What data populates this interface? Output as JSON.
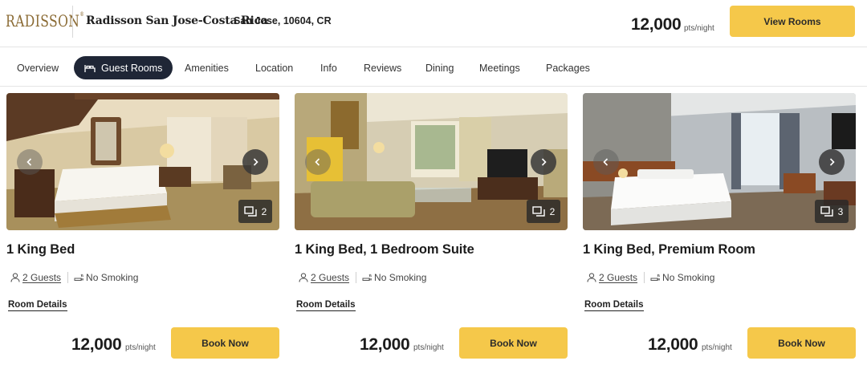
{
  "header": {
    "logo_text": "RADISSON",
    "logo_mark": "®",
    "hotel_name": "Radisson San Jose-Costa Rica",
    "address": "San Jose, 10604, CR",
    "price": "12,000",
    "price_unit": "pts/night",
    "view_rooms_label": "View Rooms",
    "accent_color": "#f5c84a",
    "brand_color": "#8a6a33"
  },
  "nav": {
    "active_color": "#1f2636",
    "tabs": [
      {
        "label": "Overview",
        "active": false
      },
      {
        "label": "Guest Rooms",
        "active": true,
        "icon": "bed-icon"
      },
      {
        "label": "Amenities",
        "active": false
      },
      {
        "label": "Location",
        "active": false
      },
      {
        "label": "Info",
        "active": false
      },
      {
        "label": "Reviews",
        "active": false
      },
      {
        "label": "Dining",
        "active": false
      },
      {
        "label": "Meetings",
        "active": false
      },
      {
        "label": "Packages",
        "active": false
      }
    ]
  },
  "rooms": [
    {
      "title": "1 King Bed",
      "photo_count": "2",
      "guests": "2 Guests",
      "smoking": "No Smoking",
      "details_label": "Room Details",
      "price": "12,000",
      "price_unit": "pts/night",
      "book_label": "Book Now"
    },
    {
      "title": "1 King Bed, 1 Bedroom Suite",
      "photo_count": "2",
      "guests": "2 Guests",
      "smoking": "No Smoking",
      "details_label": "Room Details",
      "price": "12,000",
      "price_unit": "pts/night",
      "book_label": "Book Now"
    },
    {
      "title": "1 King Bed, Premium Room",
      "photo_count": "3",
      "guests": "2 Guests",
      "smoking": "No Smoking",
      "details_label": "Room Details",
      "price": "12,000",
      "price_unit": "pts/night",
      "book_label": "Book Now"
    }
  ],
  "icons": {
    "prev": "chevron-left-icon",
    "next": "chevron-right-icon",
    "gallery": "photo-gallery-icon",
    "guests": "person-icon",
    "smoking": "no-smoking-icon"
  }
}
